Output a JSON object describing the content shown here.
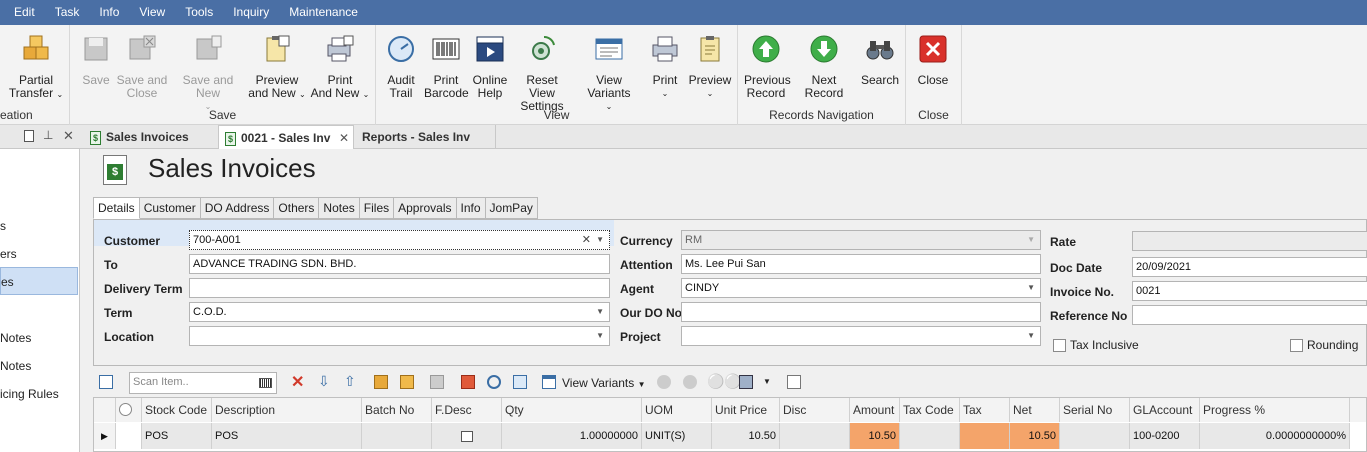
{
  "menu": [
    "Edit",
    "Task",
    "Info",
    "View",
    "Tools",
    "Inquiry",
    "Maintenance"
  ],
  "ribbon": {
    "creation_group": "eation",
    "partial_transfer": [
      "Partial",
      "Transfer"
    ],
    "save": "Save",
    "save_close": [
      "Save and",
      "Close"
    ],
    "save_new": "Save and New",
    "preview_new": [
      "Preview",
      "and New"
    ],
    "print_new": [
      "Print",
      "And New"
    ],
    "save_group": "Save",
    "audit_trail": [
      "Audit",
      "Trail"
    ],
    "print_barcode": [
      "Print",
      "Barcode"
    ],
    "online_help": [
      "Online",
      "Help"
    ],
    "reset_view": [
      "Reset View",
      "Settings"
    ],
    "view_variants": "View Variants",
    "print": "Print",
    "preview": "Preview",
    "view_group": "View",
    "previous_record": [
      "Previous",
      "Record"
    ],
    "next_record": "Next Record",
    "search": "Search",
    "nav_group": "Records Navigation",
    "close": "Close",
    "close_group": "Close"
  },
  "doc_tabs": [
    "Sales Invoices",
    "0021 - Sales Inv",
    "Reports - Sales Inv"
  ],
  "left_items": [
    "s",
    "ers",
    "es",
    "Notes",
    "Notes",
    "icing Rules"
  ],
  "page_title": "Sales Invoices",
  "form_tabs": [
    "Details",
    "Customer",
    "DO Address",
    "Others",
    "Notes",
    "Files",
    "Approvals",
    "Info",
    "JomPay"
  ],
  "form": {
    "customer_label": "Customer",
    "customer": "700-A001",
    "to_label": "To",
    "to": "ADVANCE TRADING SDN. BHD.",
    "delivery_term_label": "Delivery Term",
    "delivery_term": "",
    "term_label": "Term",
    "term": "C.O.D.",
    "location_label": "Location",
    "location": "",
    "currency_label": "Currency",
    "currency": "RM",
    "attention_label": "Attention",
    "attention": "Ms. Lee Pui San",
    "agent_label": "Agent",
    "agent": "CINDY",
    "our_do_label": "Our DO No",
    "our_do": "",
    "project_label": "Project",
    "project": "",
    "rate_label": "Rate",
    "rate": "",
    "doc_date_label": "Doc Date",
    "doc_date": "20/09/2021",
    "invoice_no_label": "Invoice No.",
    "invoice_no": "0021",
    "reference_no_label": "Reference No",
    "reference_no": "",
    "tax_inclusive_label": "Tax Inclusive",
    "rounding_label": "Rounding"
  },
  "grid_toolbar": {
    "scan_placeholder": "Scan Item..",
    "view_variants": "View Variants"
  },
  "grid": {
    "columns": [
      "Stock Code",
      "Description",
      "Batch No",
      "F.Desc",
      "Qty",
      "UOM",
      "Unit Price",
      "Disc",
      "Amount",
      "Tax Code",
      "Tax",
      "Net",
      "Serial No",
      "GLAccount",
      "Progress %"
    ],
    "row": {
      "stock_code": "POS",
      "description": "POS",
      "batch_no": "",
      "qty": "1.00000000",
      "uom": "UNIT(S)",
      "unit_price": "10.50",
      "disc": "",
      "amount": "10.50",
      "tax_code": "",
      "tax": "",
      "net": "10.50",
      "serial_no": "",
      "glaccount": "100-0200",
      "progress": "0.0000000000%"
    }
  },
  "colors": {
    "menubar": "#4a6fa5",
    "highlight": "#f4a46a",
    "selected": "#cfe0f5"
  }
}
